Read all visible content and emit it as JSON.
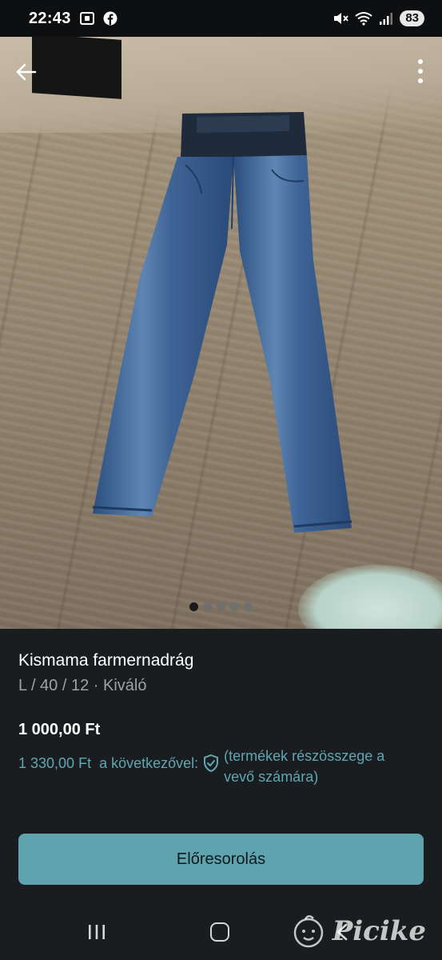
{
  "status_bar": {
    "time": "22:43",
    "battery": "83",
    "icons": [
      "screenshot-icon",
      "facebook-icon",
      "mute-icon",
      "wifi-icon",
      "signal-icon"
    ]
  },
  "top_bar": {
    "back_icon": "arrow-left-icon",
    "more_icon": "more-vertical-icon"
  },
  "gallery": {
    "image_count": 5,
    "active_index": 0
  },
  "item": {
    "title": "Kismama farmernadrág",
    "subtitle": "L / 40 / 12 · Kiváló",
    "price": "1 000,00 Ft",
    "buyer_price": "1 330,00 Ft",
    "buyer_with": "a következővel:",
    "buyer_note": "(termékek részösszege a vevő számára)"
  },
  "cta": {
    "label": "Előresorolás"
  },
  "watermark": {
    "text": "Picike"
  },
  "colors": {
    "background": "#1a1d1f",
    "accent": "#5ea3ae",
    "accent_text": "#5fa7b3",
    "muted_text": "#9aa3a7"
  }
}
